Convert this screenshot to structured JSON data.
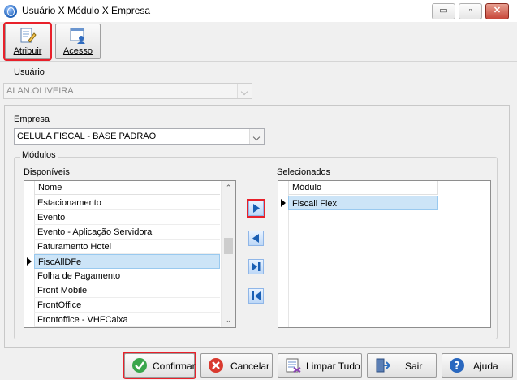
{
  "window": {
    "title": "Usuário X Módulo X Empresa",
    "minimize_label": "▭",
    "maximize_label": "▫",
    "close_label": "✕"
  },
  "toolbar": {
    "atribuir_label": "Atribuir",
    "acesso_label": "Acesso"
  },
  "usuario": {
    "label": "Usuário",
    "value": "ALAN.OLIVEIRA"
  },
  "empresa": {
    "label": "Empresa",
    "value": "CELULA FISCAL - BASE PADRAO"
  },
  "modulos": {
    "group_title": "Módulos",
    "disponiveis_label": "Disponíveis",
    "selecionados_label": "Selecionados",
    "disponiveis_header": "Nome",
    "disponiveis_items": [
      "Estacionamento",
      "Evento",
      "Evento - Aplicação Servidora",
      "Faturamento Hotel",
      "FiscAllDFe",
      "Folha de Pagamento",
      "Front Mobile",
      "FrontOffice",
      "Frontoffice - VHFCaixa"
    ],
    "selected_index": 4,
    "selecionados_header": "Módulo",
    "selecionados_items": [
      "Fiscall Flex"
    ]
  },
  "footer": {
    "confirmar_label": "Confirmar",
    "cancelar_label": "Cancelar",
    "limpar_label": "Limpar Tudo",
    "sair_label": "Sair",
    "ajuda_label": "Ajuda"
  },
  "colors": {
    "highlight_red": "#e8202a",
    "selection_blue": "#cce4f7"
  }
}
